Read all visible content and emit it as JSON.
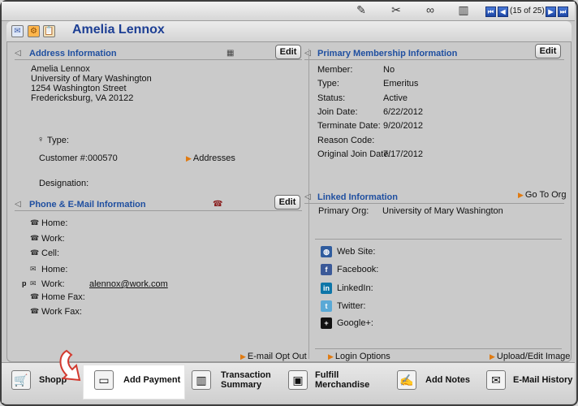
{
  "toolbar": {
    "edit_icon": "pencil-icon",
    "tools_icon": "tools-icon",
    "link_icon": "link-icon",
    "chart_icon": "chart-icon",
    "pager": "(15 of 25)",
    "first": "first",
    "prev": "prev",
    "next": "next",
    "last": "last"
  },
  "header": {
    "name": "Amelia Lennox",
    "icons": [
      "mail-icon",
      "orange-gear-icon",
      "clipboard-icon"
    ]
  },
  "address": {
    "title": "Address Information",
    "edit": "Edit",
    "lines": [
      "Amelia Lennox",
      "University of Mary Washington",
      "1254 Washington Street",
      "Fredericksburg, VA 20122"
    ],
    "type_label": "Type:",
    "customer_label": "Customer #:",
    "customer_value": "000570",
    "addresses_link": "Addresses",
    "designation_label": "Designation:"
  },
  "membership": {
    "title": "Primary Membership Information",
    "edit": "Edit",
    "rows": [
      {
        "label": "Member:",
        "value": "No"
      },
      {
        "label": "Type:",
        "value": "Emeritus"
      },
      {
        "label": "Status:",
        "value": "Active"
      },
      {
        "label": "Join Date:",
        "value": "6/22/2012"
      },
      {
        "label": "Terminate Date:",
        "value": "9/20/2012"
      },
      {
        "label": "Reason Code:",
        "value": ""
      },
      {
        "label": "Original Join Date:",
        "value": "7/17/2012"
      }
    ]
  },
  "phone": {
    "title": "Phone & E-Mail Information",
    "edit": "Edit",
    "rows": [
      {
        "label": "Home:",
        "value": ""
      },
      {
        "label": "Work:",
        "value": ""
      },
      {
        "label": "Cell:",
        "value": ""
      },
      {
        "label": "Home:",
        "value": ""
      },
      {
        "label": "Work:",
        "value": "alennox@work.com",
        "prefix": "p"
      },
      {
        "label": "Home Fax:",
        "value": ""
      },
      {
        "label": "Work Fax:",
        "value": ""
      }
    ],
    "optout": "E-mail Opt Out"
  },
  "linked": {
    "title": "Linked Information",
    "goto": "Go To Org",
    "primary_org_label": "Primary Org:",
    "primary_org_value": "University of Mary Washington",
    "social": [
      {
        "label": "Web Site:",
        "icon": "globe-icon",
        "color": "#2f5c9e"
      },
      {
        "label": "Facebook:",
        "icon": "facebook-icon",
        "color": "#3b5998"
      },
      {
        "label": "LinkedIn:",
        "icon": "linkedin-icon",
        "color": "#0e76a8"
      },
      {
        "label": "Twitter:",
        "icon": "twitter-icon",
        "color": "#5aa9d6"
      },
      {
        "label": "Google+:",
        "icon": "google-plus-icon",
        "color": "#111111"
      }
    ],
    "login_options": "Login Options",
    "upload_image": "Upload/Edit Image"
  },
  "bottom": {
    "items": [
      {
        "label": "Shopp",
        "icon": "cart-icon"
      },
      {
        "label": "Add Payment",
        "icon": "credit-card-icon"
      },
      {
        "label1": "Transaction",
        "label2": "Summary",
        "icon": "bar-chart-icon"
      },
      {
        "label1": "Fulfill",
        "label2": "Merchandise",
        "icon": "box-icon"
      },
      {
        "label": "Add Notes",
        "icon": "note-icon"
      },
      {
        "label": "E-Mail History",
        "icon": "email-history-icon"
      }
    ],
    "accent": "#d23a2f"
  }
}
